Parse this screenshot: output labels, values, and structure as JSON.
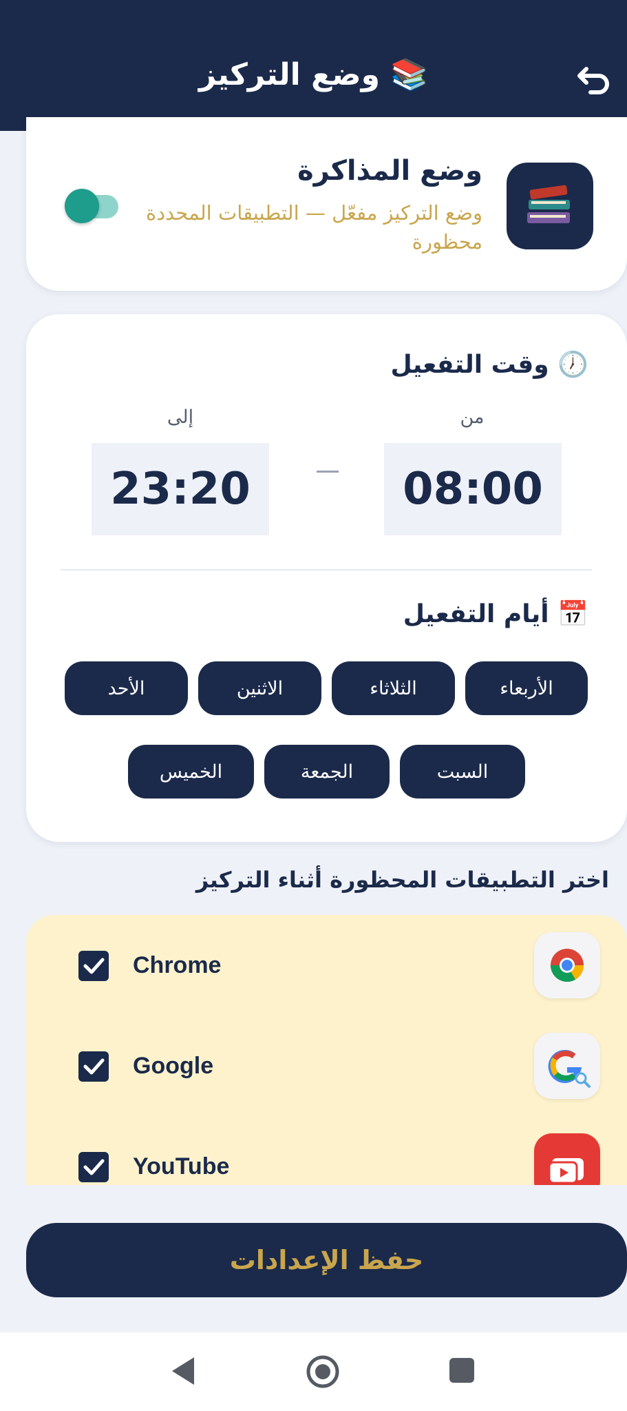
{
  "header": {
    "title": "📚 وضع التركيز",
    "back_icon": "undo-arrow-icon"
  },
  "focus_mode": {
    "title": "وضع المذاكرة",
    "subtitle": "وضع التركيز مفعّل — التطبيقات المحددة محظورة",
    "icon": "books-icon",
    "enabled": true
  },
  "schedule": {
    "time_title": "🕖 وقت التفعيل",
    "from_label": "من",
    "to_label": "إلى",
    "from_time": "08:00",
    "to_time": "23:20",
    "days_title": "📅 أيام التفعيل",
    "days": [
      "الأربعاء",
      "الثلاثاء",
      "الاثنين",
      "الأحد",
      "السبت",
      "الجمعة",
      "الخميس"
    ]
  },
  "apps": {
    "heading": "اختر التطبيقات المحظورة أثناء التركيز",
    "items": [
      {
        "name": "Chrome",
        "checked": true,
        "icon": "chrome-icon"
      },
      {
        "name": "Google",
        "checked": true,
        "icon": "google-icon"
      },
      {
        "name": "YouTube",
        "checked": true,
        "icon": "youtube-icon"
      }
    ]
  },
  "save_label": "حفظ الإعدادات",
  "colors": {
    "navy": "#1b2a4a",
    "gold": "#c9a64d",
    "teal": "#1e9c8c",
    "panel": "#fdf2cc"
  }
}
